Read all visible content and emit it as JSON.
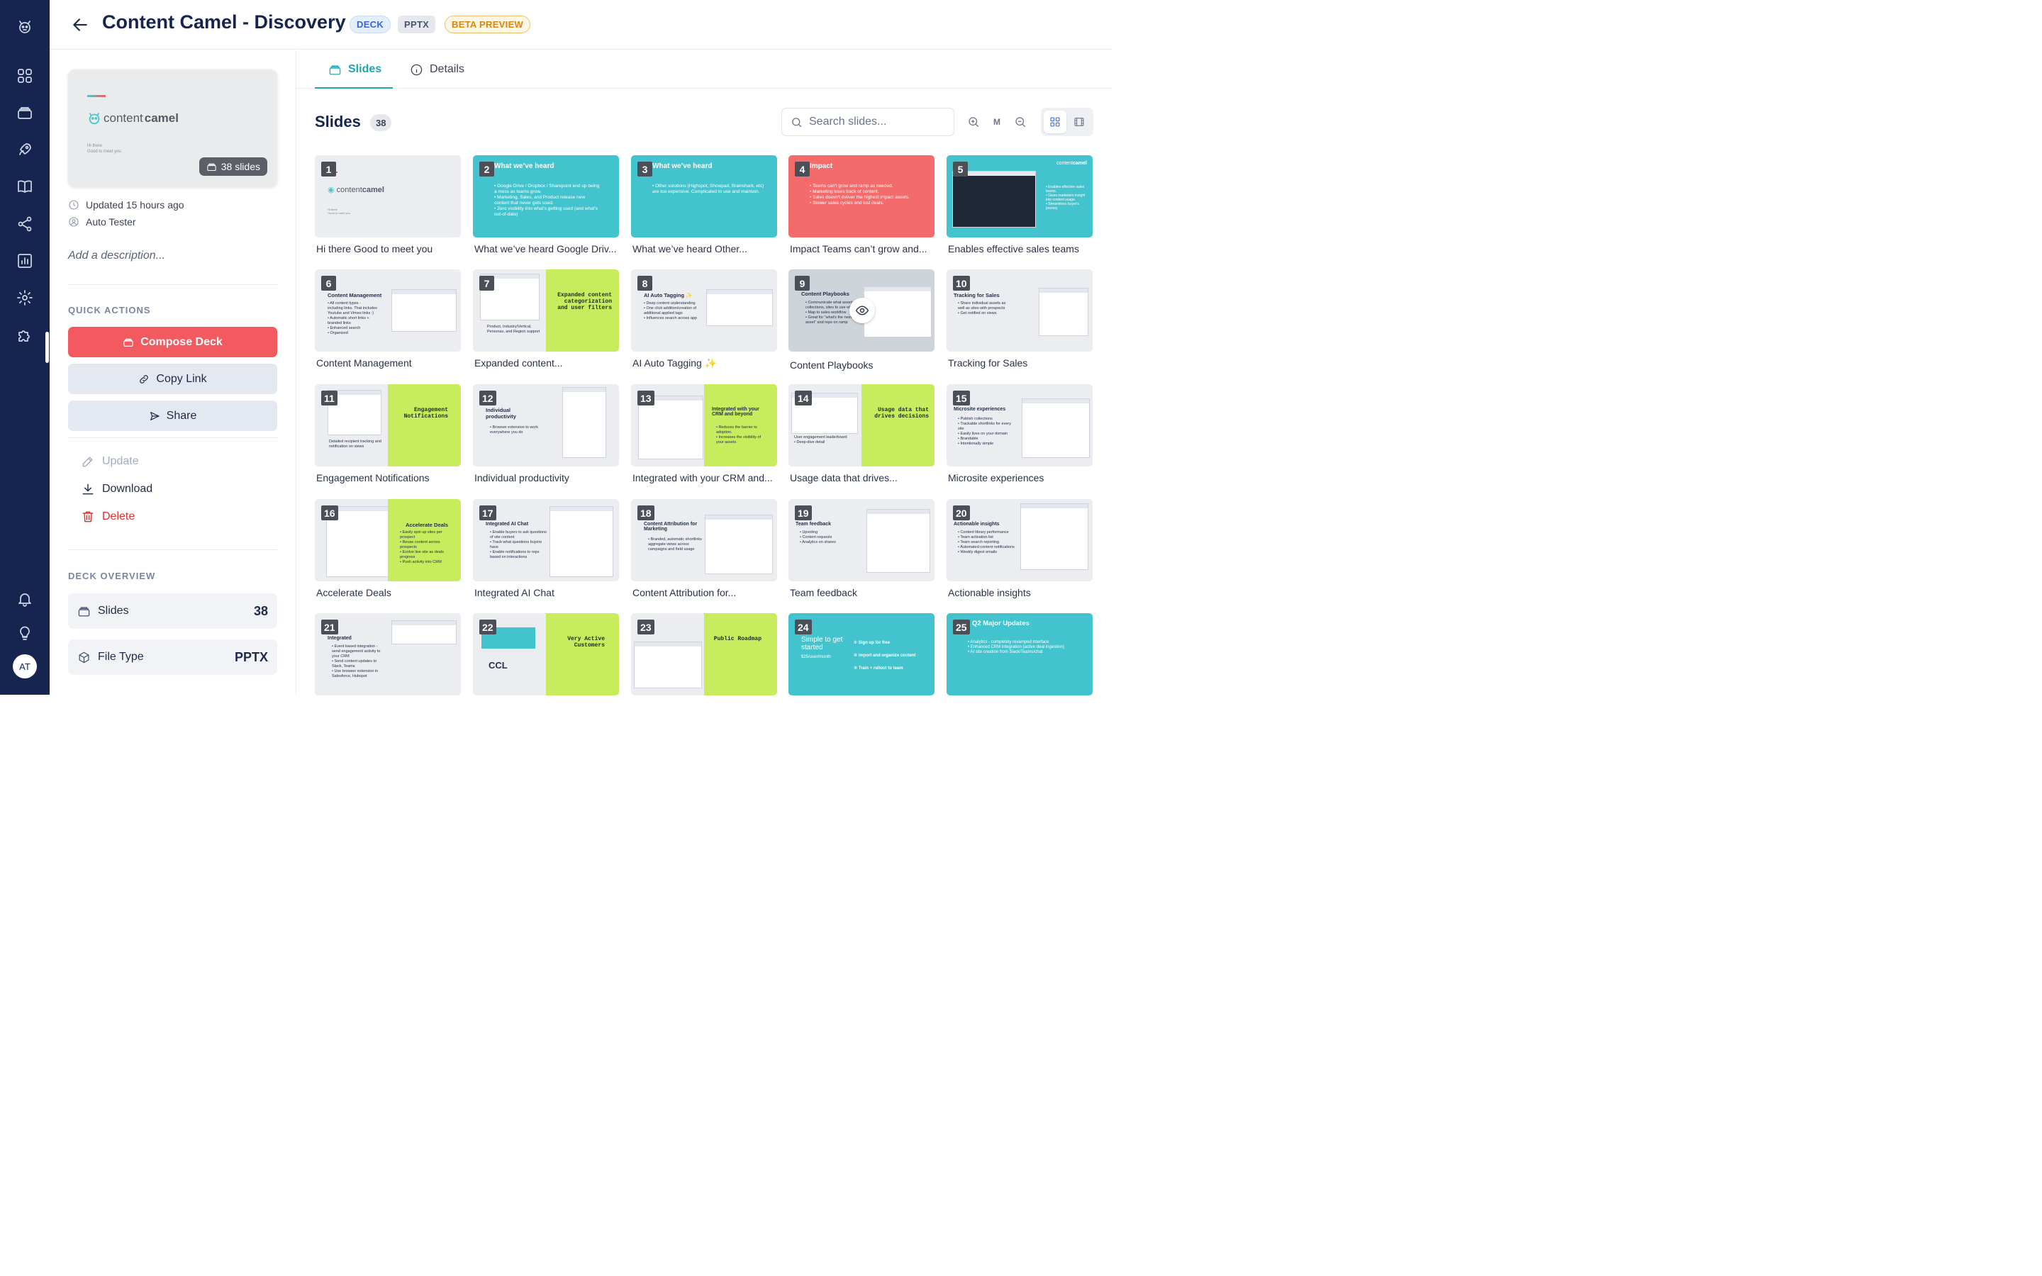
{
  "header": {
    "title": "Content Camel - Discovery",
    "badges": {
      "deck": "DECK",
      "pptx": "PPTX",
      "beta": "BETA PREVIEW"
    }
  },
  "sidebar": {
    "avatar": "AT"
  },
  "deck_card": {
    "logo_text_light": "content",
    "logo_text_bold": "camel",
    "greeting": "Hi there\nGood to meet you",
    "slide_count": "38 slides"
  },
  "meta": {
    "updated": "Updated 15 hours ago",
    "author": "Auto Tester"
  },
  "description_placeholder": "Add a description...",
  "quick_actions": {
    "label": "QUICK ACTIONS",
    "compose": "Compose Deck",
    "copy_link": "Copy Link",
    "share": "Share",
    "update": "Update",
    "download": "Download",
    "delete": "Delete"
  },
  "overview": {
    "label": "DECK OVERVIEW",
    "slides_label": "Slides",
    "slides_value": "38",
    "filetype_label": "File Type",
    "filetype_value": "PPTX"
  },
  "tabs": {
    "slides": "Slides",
    "details": "Details"
  },
  "slides_section": {
    "title": "Slides",
    "count": "38",
    "search_placeholder": "Search slides...",
    "zoom_level": "M"
  },
  "slides": [
    {
      "n": "1",
      "caption": "Hi there Good to meet you"
    },
    {
      "n": "2",
      "caption": "What we’ve heard Google Driv...",
      "head": "What we’ve heard",
      "body": "• Google Drive / Dropbox / Sharepoint end up being a mess as teams grow.\n• Marketing, Sales, and Product release new content that never gets used.\n• Zero visibility into what's getting used (and what's out-of-date)"
    },
    {
      "n": "3",
      "caption": "What we’ve heard Other...",
      "head": "What we’ve heard",
      "body": "• Other solutions (Highspot, Showpad, Brainshark, etc) are too expensive. Complicated to use and maintain."
    },
    {
      "n": "4",
      "caption": "Impact Teams can’t grow and...",
      "head": "Impact",
      "body": "• Teams can't grow and ramp as needed.\n• Marketing loses track of content.\n• Sales doesn't deliver the highest impact assets.\n• Slower sales cycles and lost deals."
    },
    {
      "n": "5",
      "caption": "Enables effective sales teams",
      "body": "• Enables effective sales teams.\n• Gives marketers insight into content usage.\n• Streamlines buyer's journey."
    },
    {
      "n": "6",
      "caption": "Content Management",
      "head": "Content Management",
      "body": "• All content types - including links. That includes Youtube and Vimeo links :)\n• Automatic short links + branded links\n• Enhanced search\n• Organized"
    },
    {
      "n": "7",
      "caption": "Expanded content...",
      "head": "Expanded content categorization and user filters",
      "body": "Product, Industry/Vertical, Personas, and Region support"
    },
    {
      "n": "8",
      "caption": "AI Auto Tagging ✨",
      "head": "AI Auto Tagging ✨",
      "body": "• Deep content understanding\n• One click addition/creation of additional applied tags\n• Influences search across app"
    },
    {
      "n": "9",
      "caption": "Content Playbooks",
      "head": "Content Playbooks",
      "body": "• Communicate what assets, collections, sites to use when\n• Map to sales workflow\n• Great for “what's the next asset” and reps on ramp"
    },
    {
      "n": "10",
      "caption": "Tracking for Sales",
      "head": "Tracking for Sales",
      "body": "• Share individual assets as well as sites with prospects\n• Get notified on views"
    },
    {
      "n": "11",
      "caption": "Engagement Notifications",
      "head": "Engagement Notifications",
      "body": "Detailed recipient tracking and notification on views"
    },
    {
      "n": "12",
      "caption": "Individual productivity",
      "head": "Individual productivity",
      "body": "• Browser extension to work everywhere you do"
    },
    {
      "n": "13",
      "caption": "Integrated with your CRM and...",
      "head": "Integrated with your CRM and beyond",
      "body": "• Reduces the barrier to adoption.\n• Increases the visibility of your assets."
    },
    {
      "n": "14",
      "caption": "Usage data that drives...",
      "head": "Usage data that drives decisions",
      "body": "User engagement leaderboard\n• Deep-dive detail"
    },
    {
      "n": "15",
      "caption": "Microsite experiences",
      "head": "Microsite experiences",
      "body": "• Publish collections\n• Trackable shortlinks for every site\n• Easily lives on your domain\n• Brandable\n• Intentionally simple"
    },
    {
      "n": "16",
      "caption": "Accelerate Deals",
      "head": "Accelerate Deals",
      "body": "• Easily spin up sites per prospect\n• Reuse content across prospects\n• Evolve live site as deals progress\n• Push activity into CRM"
    },
    {
      "n": "17",
      "caption": "Integrated AI Chat",
      "head": "Integrated AI Chat",
      "body": "• Enable buyers to ask questions of site content\n• Track what questions buyers have\n• Enable notifications to reps based on interactions"
    },
    {
      "n": "18",
      "caption": "Content Attribution for...",
      "head": "Content Attribution for Marketing",
      "body": "• Branded, automatic shortlinks aggregate views across campaigns and field usage"
    },
    {
      "n": "19",
      "caption": "Team feedback",
      "head": "Team feedback",
      "body": "• Upvoting\n• Content requests\n• Analytics on shares"
    },
    {
      "n": "20",
      "caption": "Actionable insights",
      "head": "Actionable insights",
      "body": "• Content library performance\n• Team activation list\n• Team search reporting\n• Automated content notifications\n• Weekly digest emails"
    },
    {
      "n": "21",
      "caption": "",
      "head": "Integrated",
      "body": "• Event based integration - send engagement activity to your CRM\n• Send content updates to Slack, Teams\n• Use browser extension in Salesforce, Hubspot"
    },
    {
      "n": "22",
      "caption": "",
      "head": "Very Active Customers",
      "body": "CCL"
    },
    {
      "n": "23",
      "caption": "",
      "head": "Public Roadmap"
    },
    {
      "n": "24",
      "caption": "",
      "head": "Simple to get started",
      "body": "$25/user/month",
      "steps": [
        "Sign up for free",
        "Import and organize content",
        "Train + rollout to team"
      ]
    },
    {
      "n": "25",
      "caption": "",
      "head": "Q2 Major Updates",
      "body": "• Analytics - completely revamped interface\n• Enhanced CRM integration (active deal ingestion)\n• AI site creation from Slack/Teams/chat"
    }
  ],
  "colors": {
    "teal": "#43c3cd",
    "coral": "#f46b6b",
    "lime": "#c7ec5d",
    "navy": "#16254f",
    "accent": "#1fa5b3"
  }
}
